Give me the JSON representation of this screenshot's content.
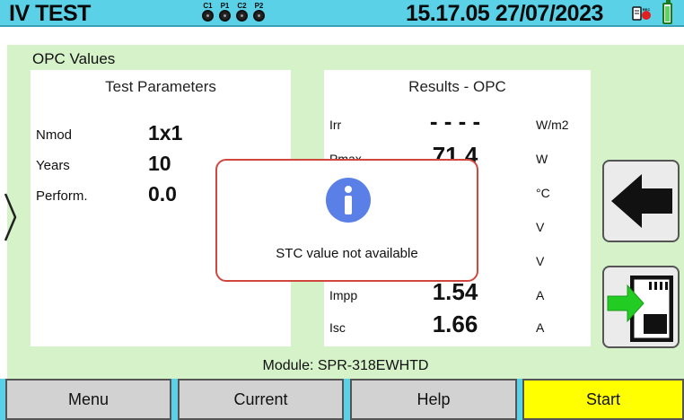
{
  "header": {
    "title": "IV TEST",
    "probes": [
      "C1",
      "P1",
      "C2",
      "P2"
    ],
    "datetime": "15.17.05 27/07/2023",
    "rec_label": "REC"
  },
  "main": {
    "section_title": "OPC Values",
    "test_parameters": {
      "title": "Test Parameters",
      "rows": [
        {
          "label": "Nmod",
          "value": "1x1"
        },
        {
          "label": "Years",
          "value": "10"
        },
        {
          "label": "Perform.",
          "value": "0.0"
        }
      ]
    },
    "results": {
      "title": "Results - OPC",
      "rows": [
        {
          "label": "Irr",
          "value": "- - - -",
          "unit": "W/m2"
        },
        {
          "label": "Pmax",
          "value": "71.4",
          "unit": "W"
        },
        {
          "label": "",
          "value": "",
          "unit": "°C"
        },
        {
          "label": "",
          "value": "",
          "unit": "V"
        },
        {
          "label": "",
          "value": "",
          "unit": "V"
        },
        {
          "label": "Impp",
          "value": "1.54",
          "unit": "A"
        },
        {
          "label": "Isc",
          "value": "1.66",
          "unit": "A"
        }
      ]
    },
    "module_info": "Module: SPR-318EWHTD"
  },
  "modal": {
    "message": "STC value not available"
  },
  "bottom_bar": {
    "menu": "Menu",
    "current": "Current",
    "help": "Help",
    "start": "Start"
  },
  "colors": {
    "header_bg": "#5ad1e6",
    "main_bg": "#d5f2c9",
    "start_button": "#ffff00",
    "modal_border": "#d0473e",
    "info_icon": "#5a7fe6",
    "save_arrow": "#22cc22"
  },
  "icons": {
    "info": "info-icon",
    "back": "arrow-left-icon",
    "save": "save-to-sd-card-icon",
    "battery": "battery-icon",
    "record": "record-icon",
    "expand": "chevron-right-icon"
  }
}
